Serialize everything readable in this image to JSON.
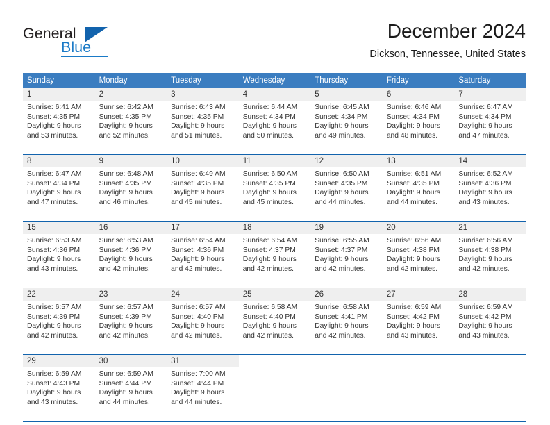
{
  "logo": {
    "word1": "General",
    "word2": "Blue",
    "icon": "triangle-flag-icon"
  },
  "header": {
    "title": "December 2024",
    "location": "Dickson, Tennessee, United States"
  },
  "calendar": {
    "weekday_headers": [
      "Sunday",
      "Monday",
      "Tuesday",
      "Wednesday",
      "Thursday",
      "Friday",
      "Saturday"
    ],
    "colors": {
      "header_blue": "#3b7dc0",
      "separator_blue": "#1263ad",
      "daynum_band": "#efefef",
      "text": "#333333",
      "logo_blue": "#1a7ac7"
    },
    "weeks": [
      [
        {
          "day": "1",
          "sunrise": "Sunrise: 6:41 AM",
          "sunset": "Sunset: 4:35 PM",
          "daylight1": "Daylight: 9 hours",
          "daylight2": "and 53 minutes."
        },
        {
          "day": "2",
          "sunrise": "Sunrise: 6:42 AM",
          "sunset": "Sunset: 4:35 PM",
          "daylight1": "Daylight: 9 hours",
          "daylight2": "and 52 minutes."
        },
        {
          "day": "3",
          "sunrise": "Sunrise: 6:43 AM",
          "sunset": "Sunset: 4:35 PM",
          "daylight1": "Daylight: 9 hours",
          "daylight2": "and 51 minutes."
        },
        {
          "day": "4",
          "sunrise": "Sunrise: 6:44 AM",
          "sunset": "Sunset: 4:34 PM",
          "daylight1": "Daylight: 9 hours",
          "daylight2": "and 50 minutes."
        },
        {
          "day": "5",
          "sunrise": "Sunrise: 6:45 AM",
          "sunset": "Sunset: 4:34 PM",
          "daylight1": "Daylight: 9 hours",
          "daylight2": "and 49 minutes."
        },
        {
          "day": "6",
          "sunrise": "Sunrise: 6:46 AM",
          "sunset": "Sunset: 4:34 PM",
          "daylight1": "Daylight: 9 hours",
          "daylight2": "and 48 minutes."
        },
        {
          "day": "7",
          "sunrise": "Sunrise: 6:47 AM",
          "sunset": "Sunset: 4:34 PM",
          "daylight1": "Daylight: 9 hours",
          "daylight2": "and 47 minutes."
        }
      ],
      [
        {
          "day": "8",
          "sunrise": "Sunrise: 6:47 AM",
          "sunset": "Sunset: 4:34 PM",
          "daylight1": "Daylight: 9 hours",
          "daylight2": "and 47 minutes."
        },
        {
          "day": "9",
          "sunrise": "Sunrise: 6:48 AM",
          "sunset": "Sunset: 4:35 PM",
          "daylight1": "Daylight: 9 hours",
          "daylight2": "and 46 minutes."
        },
        {
          "day": "10",
          "sunrise": "Sunrise: 6:49 AM",
          "sunset": "Sunset: 4:35 PM",
          "daylight1": "Daylight: 9 hours",
          "daylight2": "and 45 minutes."
        },
        {
          "day": "11",
          "sunrise": "Sunrise: 6:50 AM",
          "sunset": "Sunset: 4:35 PM",
          "daylight1": "Daylight: 9 hours",
          "daylight2": "and 45 minutes."
        },
        {
          "day": "12",
          "sunrise": "Sunrise: 6:50 AM",
          "sunset": "Sunset: 4:35 PM",
          "daylight1": "Daylight: 9 hours",
          "daylight2": "and 44 minutes."
        },
        {
          "day": "13",
          "sunrise": "Sunrise: 6:51 AM",
          "sunset": "Sunset: 4:35 PM",
          "daylight1": "Daylight: 9 hours",
          "daylight2": "and 44 minutes."
        },
        {
          "day": "14",
          "sunrise": "Sunrise: 6:52 AM",
          "sunset": "Sunset: 4:36 PM",
          "daylight1": "Daylight: 9 hours",
          "daylight2": "and 43 minutes."
        }
      ],
      [
        {
          "day": "15",
          "sunrise": "Sunrise: 6:53 AM",
          "sunset": "Sunset: 4:36 PM",
          "daylight1": "Daylight: 9 hours",
          "daylight2": "and 43 minutes."
        },
        {
          "day": "16",
          "sunrise": "Sunrise: 6:53 AM",
          "sunset": "Sunset: 4:36 PM",
          "daylight1": "Daylight: 9 hours",
          "daylight2": "and 42 minutes."
        },
        {
          "day": "17",
          "sunrise": "Sunrise: 6:54 AM",
          "sunset": "Sunset: 4:36 PM",
          "daylight1": "Daylight: 9 hours",
          "daylight2": "and 42 minutes."
        },
        {
          "day": "18",
          "sunrise": "Sunrise: 6:54 AM",
          "sunset": "Sunset: 4:37 PM",
          "daylight1": "Daylight: 9 hours",
          "daylight2": "and 42 minutes."
        },
        {
          "day": "19",
          "sunrise": "Sunrise: 6:55 AM",
          "sunset": "Sunset: 4:37 PM",
          "daylight1": "Daylight: 9 hours",
          "daylight2": "and 42 minutes."
        },
        {
          "day": "20",
          "sunrise": "Sunrise: 6:56 AM",
          "sunset": "Sunset: 4:38 PM",
          "daylight1": "Daylight: 9 hours",
          "daylight2": "and 42 minutes."
        },
        {
          "day": "21",
          "sunrise": "Sunrise: 6:56 AM",
          "sunset": "Sunset: 4:38 PM",
          "daylight1": "Daylight: 9 hours",
          "daylight2": "and 42 minutes."
        }
      ],
      [
        {
          "day": "22",
          "sunrise": "Sunrise: 6:57 AM",
          "sunset": "Sunset: 4:39 PM",
          "daylight1": "Daylight: 9 hours",
          "daylight2": "and 42 minutes."
        },
        {
          "day": "23",
          "sunrise": "Sunrise: 6:57 AM",
          "sunset": "Sunset: 4:39 PM",
          "daylight1": "Daylight: 9 hours",
          "daylight2": "and 42 minutes."
        },
        {
          "day": "24",
          "sunrise": "Sunrise: 6:57 AM",
          "sunset": "Sunset: 4:40 PM",
          "daylight1": "Daylight: 9 hours",
          "daylight2": "and 42 minutes."
        },
        {
          "day": "25",
          "sunrise": "Sunrise: 6:58 AM",
          "sunset": "Sunset: 4:40 PM",
          "daylight1": "Daylight: 9 hours",
          "daylight2": "and 42 minutes."
        },
        {
          "day": "26",
          "sunrise": "Sunrise: 6:58 AM",
          "sunset": "Sunset: 4:41 PM",
          "daylight1": "Daylight: 9 hours",
          "daylight2": "and 42 minutes."
        },
        {
          "day": "27",
          "sunrise": "Sunrise: 6:59 AM",
          "sunset": "Sunset: 4:42 PM",
          "daylight1": "Daylight: 9 hours",
          "daylight2": "and 43 minutes."
        },
        {
          "day": "28",
          "sunrise": "Sunrise: 6:59 AM",
          "sunset": "Sunset: 4:42 PM",
          "daylight1": "Daylight: 9 hours",
          "daylight2": "and 43 minutes."
        }
      ],
      [
        {
          "day": "29",
          "sunrise": "Sunrise: 6:59 AM",
          "sunset": "Sunset: 4:43 PM",
          "daylight1": "Daylight: 9 hours",
          "daylight2": "and 43 minutes."
        },
        {
          "day": "30",
          "sunrise": "Sunrise: 6:59 AM",
          "sunset": "Sunset: 4:44 PM",
          "daylight1": "Daylight: 9 hours",
          "daylight2": "and 44 minutes."
        },
        {
          "day": "31",
          "sunrise": "Sunrise: 7:00 AM",
          "sunset": "Sunset: 4:44 PM",
          "daylight1": "Daylight: 9 hours",
          "daylight2": "and 44 minutes."
        },
        {
          "day": "",
          "sunrise": "",
          "sunset": "",
          "daylight1": "",
          "daylight2": ""
        },
        {
          "day": "",
          "sunrise": "",
          "sunset": "",
          "daylight1": "",
          "daylight2": ""
        },
        {
          "day": "",
          "sunrise": "",
          "sunset": "",
          "daylight1": "",
          "daylight2": ""
        },
        {
          "day": "",
          "sunrise": "",
          "sunset": "",
          "daylight1": "",
          "daylight2": ""
        }
      ]
    ]
  }
}
